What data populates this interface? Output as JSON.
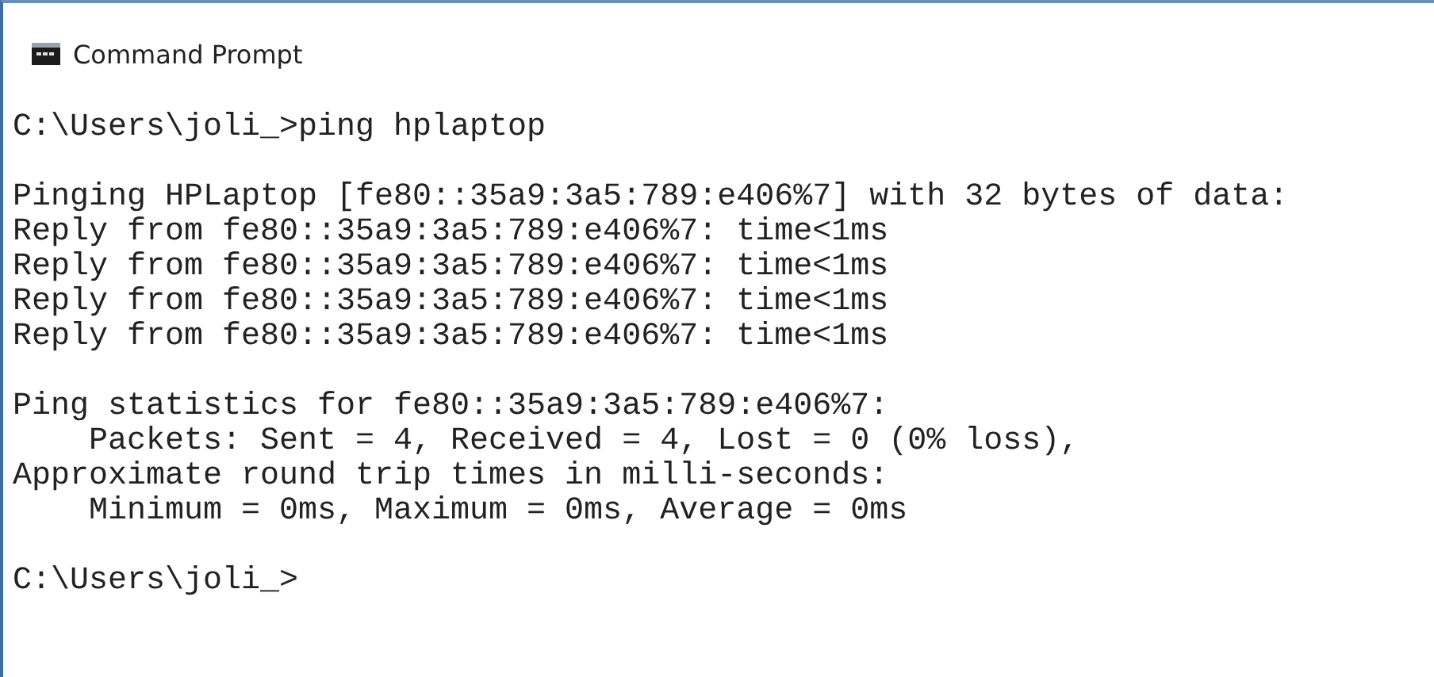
{
  "window": {
    "title": "Command Prompt"
  },
  "console": {
    "blocks": [
      [
        "C:\\Users\\joli_>ping hplaptop"
      ],
      [
        "Pinging HPLaptop [fe80::35a9:3a5:789:e406%7] with 32 bytes of data:",
        "Reply from fe80::35a9:3a5:789:e406%7: time<1ms",
        "Reply from fe80::35a9:3a5:789:e406%7: time<1ms",
        "Reply from fe80::35a9:3a5:789:e406%7: time<1ms",
        "Reply from fe80::35a9:3a5:789:e406%7: time<1ms"
      ],
      [
        "Ping statistics for fe80::35a9:3a5:789:e406%7:",
        "    Packets: Sent = 4, Received = 4, Lost = 0 (0% loss),",
        "Approximate round trip times in milli-seconds:",
        "    Minimum = 0ms, Maximum = 0ms, Average = 0ms"
      ],
      [
        "C:\\Users\\joli_>"
      ]
    ]
  }
}
